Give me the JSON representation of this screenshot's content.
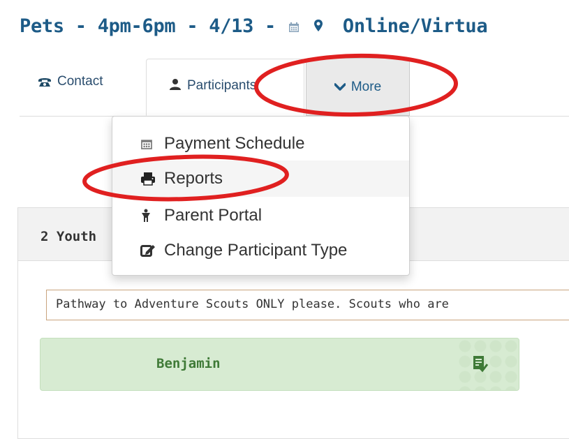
{
  "page": {
    "title_prefix": "Pets - 4pm-6pm - 4/13 -",
    "title_location": "Online/Virtua"
  },
  "tabs": {
    "contact": {
      "label": "Contact",
      "icon": "phone-icon"
    },
    "participants": {
      "label": "Participants",
      "icon": "user-icon"
    },
    "more": {
      "label": "More",
      "icon": "chevron-down-icon"
    }
  },
  "dropdown": {
    "items": [
      {
        "label": "Payment Schedule",
        "icon": "calendar-icon"
      },
      {
        "label": "Reports",
        "icon": "print-icon"
      },
      {
        "label": "Parent Portal",
        "icon": "child-icon"
      },
      {
        "label": "Change Participant Type",
        "icon": "edit-icon"
      }
    ]
  },
  "panel": {
    "title": "2 Youth",
    "notice": "Pathway to Adventure Scouts ONLY please. Scouts who are"
  },
  "participant": {
    "name": "Benjamin",
    "icon": "checklist-icon"
  },
  "colors": {
    "title": "#1d5b87",
    "annotation": "#e02020",
    "card_bg": "#d7ebd2",
    "card_text": "#3f7a37"
  }
}
